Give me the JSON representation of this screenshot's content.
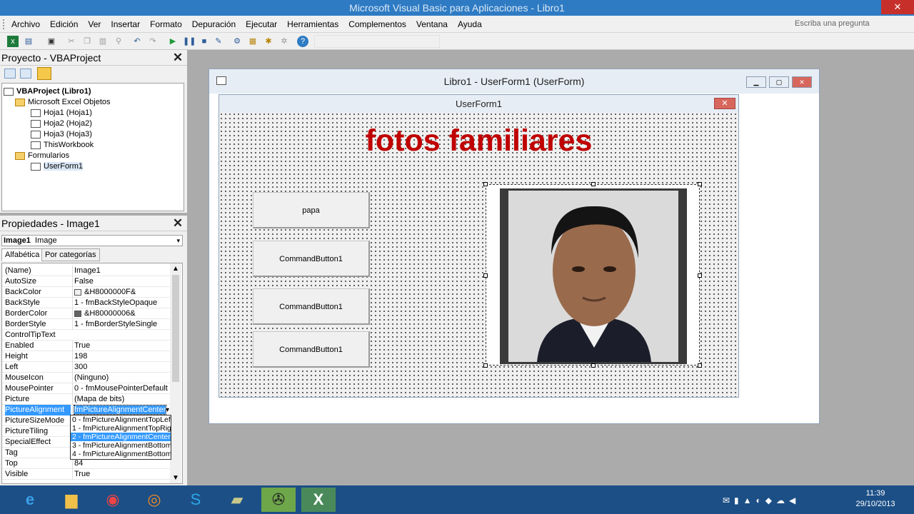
{
  "window": {
    "title": "Microsoft Visual Basic para Aplicaciones - Libro1",
    "close_glyph": "✕"
  },
  "menu": [
    "Archivo",
    "Edición",
    "Ver",
    "Insertar",
    "Formato",
    "Depuración",
    "Ejecutar",
    "Herramientas",
    "Complementos",
    "Ventana",
    "Ayuda"
  ],
  "ask": {
    "placeholder": "Escriba una pregunta"
  },
  "project": {
    "title": "Proyecto - VBAProject",
    "close": "✕",
    "tree": [
      {
        "label": "VBAProject (Libro1)",
        "bold": true
      },
      {
        "label": "Microsoft Excel Objetos"
      },
      {
        "label": "Hoja1 (Hoja1)"
      },
      {
        "label": "Hoja2 (Hoja2)"
      },
      {
        "label": "Hoja3 (Hoja3)"
      },
      {
        "label": "ThisWorkbook"
      },
      {
        "label": "Formularios"
      },
      {
        "label": "UserForm1"
      }
    ]
  },
  "properties": {
    "title": "Propiedades - Image1",
    "close": "✕",
    "object_name": "Image1",
    "object_type": "Image",
    "tabs": [
      "Alfabética",
      "Por categorías"
    ],
    "rows": [
      {
        "name": "(Name)",
        "value": "Image1"
      },
      {
        "name": "AutoSize",
        "value": "False"
      },
      {
        "name": "BackColor",
        "value": "&H8000000F&",
        "swatch": "#f0f0f0"
      },
      {
        "name": "BackStyle",
        "value": "1 - fmBackStyleOpaque"
      },
      {
        "name": "BorderColor",
        "value": "&H80000006&",
        "swatch": "#646464"
      },
      {
        "name": "BorderStyle",
        "value": "1 - fmBorderStyleSingle"
      },
      {
        "name": "ControlTipText",
        "value": ""
      },
      {
        "name": "Enabled",
        "value": "True"
      },
      {
        "name": "Height",
        "value": "198"
      },
      {
        "name": "Left",
        "value": "300"
      },
      {
        "name": "MouseIcon",
        "value": "(Ninguno)"
      },
      {
        "name": "MousePointer",
        "value": "0 - fmMousePointerDefault"
      },
      {
        "name": "Picture",
        "value": "(Mapa de bits)"
      },
      {
        "name": "PictureAlignment",
        "value": "fmPictureAlignmentCenter"
      },
      {
        "name": "PictureSizeMode",
        "value": ""
      },
      {
        "name": "PictureTiling",
        "value": ""
      },
      {
        "name": "SpecialEffect",
        "value": ""
      },
      {
        "name": "Tag",
        "value": ""
      },
      {
        "name": "Top",
        "value": "84"
      },
      {
        "name": "Visible",
        "value": "True"
      }
    ],
    "dropdown": [
      "0 - fmPictureAlignmentTopLeft",
      "1 - fmPictureAlignmentTopRight",
      "2 - fmPictureAlignmentCenter",
      "3 - fmPictureAlignmentBottomLeft",
      "4 - fmPictureAlignmentBottomRight"
    ]
  },
  "designer": {
    "title": "Libro1 - UserForm1 (UserForm)",
    "btn_min": "▁",
    "btn_max": "▢",
    "btn_close": "✕"
  },
  "userform": {
    "title": "UserForm1",
    "close": "✕",
    "heading": "fotos familiares",
    "buttons": [
      "papa",
      "CommandButton1",
      "CommandButton1",
      "CommandButton1"
    ]
  },
  "taskbar": {
    "time": "11:39",
    "date": "29/10/2013"
  },
  "colors": {
    "accent": "#2e7bc4",
    "heading": "#c00000",
    "selection": "#3399ff",
    "taskbar": "#1c4f86"
  }
}
